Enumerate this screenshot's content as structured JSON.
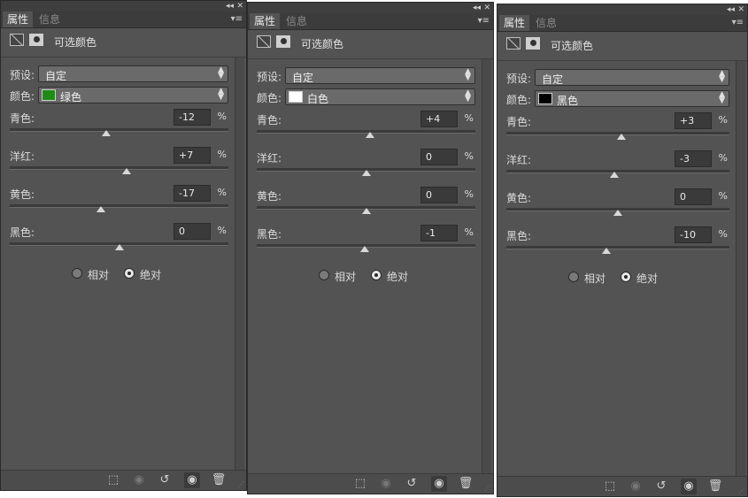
{
  "tabs": {
    "properties": "属性",
    "info": "信息"
  },
  "panel_controls": {
    "collapse": "◂◂",
    "close": "✕",
    "menu": "▾≡"
  },
  "header": {
    "title": "可选颜色",
    "adjust_icon": "selective-color-icon",
    "mask_icon": "layer-mask-icon"
  },
  "labels": {
    "preset": "预设:",
    "color": "颜色:",
    "percent": "%"
  },
  "slider_names": [
    "青色:",
    "洋红:",
    "黄色:",
    "黑色:"
  ],
  "method": {
    "relative": "相对",
    "absolute": "绝对",
    "selected": "absolute"
  },
  "footer_icons": [
    "clip-to-layer-icon",
    "view-previous-icon",
    "reset-icon",
    "visibility-icon",
    "delete-icon"
  ],
  "panels": [
    {
      "preset": "自定",
      "color": "绿色",
      "swatch": "#1e8c14",
      "sliders": [
        {
          "value": "-12",
          "level": -12
        },
        {
          "value": "+7",
          "level": 7
        },
        {
          "value": "-17",
          "level": -17
        },
        {
          "value": "0",
          "level": 0
        }
      ]
    },
    {
      "preset": "自定",
      "color": "白色",
      "swatch": "#ffffff",
      "sliders": [
        {
          "value": "+4",
          "level": 4
        },
        {
          "value": "0",
          "level": 0
        },
        {
          "value": "0",
          "level": 0
        },
        {
          "value": "-1",
          "level": -1
        }
      ]
    },
    {
      "preset": "自定",
      "color": "黑色",
      "swatch": "#000000",
      "sliders": [
        {
          "value": "+3",
          "level": 3
        },
        {
          "value": "-3",
          "level": -3
        },
        {
          "value": "0",
          "level": 0
        },
        {
          "value": "-10",
          "level": -10
        }
      ]
    }
  ]
}
